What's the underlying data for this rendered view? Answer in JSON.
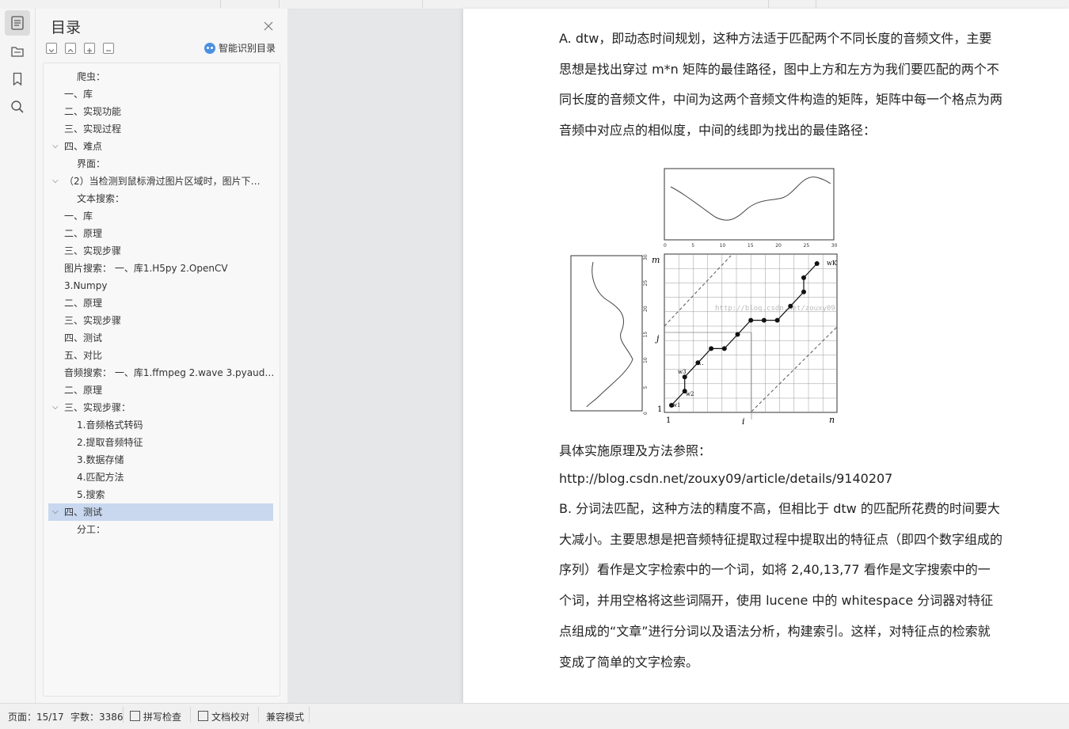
{
  "toc": {
    "title": "目录",
    "smart_label": "智能识别目录",
    "items": [
      {
        "text": "爬虫：",
        "indent": 2,
        "chevron": false,
        "selected": false
      },
      {
        "text": "一、库",
        "indent": 1,
        "chevron": false,
        "selected": false
      },
      {
        "text": "二、实现功能",
        "indent": 1,
        "chevron": false,
        "selected": false
      },
      {
        "text": "三、实现过程",
        "indent": 1,
        "chevron": false,
        "selected": false
      },
      {
        "text": "四、难点",
        "indent": 1,
        "chevron": true,
        "selected": false
      },
      {
        "text": "界面：",
        "indent": 2,
        "chevron": false,
        "selected": false
      },
      {
        "text": "（2）当检测到鼠标滑过图片区域时，图片下…",
        "indent": 1,
        "chevron": true,
        "selected": false
      },
      {
        "text": "文本搜索：",
        "indent": 2,
        "chevron": false,
        "selected": false
      },
      {
        "text": "一、库",
        "indent": 1,
        "chevron": false,
        "selected": false
      },
      {
        "text": "二、原理",
        "indent": 1,
        "chevron": false,
        "selected": false
      },
      {
        "text": "三、实现步骤",
        "indent": 1,
        "chevron": false,
        "selected": false
      },
      {
        "text": "图片搜索：  一、库1.H5py 2.OpenCV",
        "indent": 1,
        "chevron": false,
        "selected": false
      },
      {
        "text": "3.Numpy",
        "indent": 1,
        "chevron": false,
        "selected": false
      },
      {
        "text": "二、原理",
        "indent": 1,
        "chevron": false,
        "selected": false
      },
      {
        "text": "三、实现步骤",
        "indent": 1,
        "chevron": false,
        "selected": false
      },
      {
        "text": "四、测试",
        "indent": 1,
        "chevron": false,
        "selected": false
      },
      {
        "text": "五、对比",
        "indent": 1,
        "chevron": false,
        "selected": false
      },
      {
        "text": "音频搜索：  一、库1.ffmpeg 2.wave 3.pyaud…",
        "indent": 1,
        "chevron": false,
        "selected": false
      },
      {
        "text": "二、原理",
        "indent": 1,
        "chevron": false,
        "selected": false
      },
      {
        "text": "三、实现步骤：",
        "indent": 1,
        "chevron": true,
        "selected": false
      },
      {
        "text": "1.音频格式转码",
        "indent": 2,
        "chevron": false,
        "selected": false
      },
      {
        "text": "2.提取音频特征",
        "indent": 2,
        "chevron": false,
        "selected": false
      },
      {
        "text": "3.数据存储",
        "indent": 2,
        "chevron": false,
        "selected": false
      },
      {
        "text": "4.匹配方法",
        "indent": 2,
        "chevron": false,
        "selected": false
      },
      {
        "text": "5.搜索",
        "indent": 2,
        "chevron": false,
        "selected": false
      },
      {
        "text": "四、测试",
        "indent": 1,
        "chevron": true,
        "selected": true
      },
      {
        "text": "分工：",
        "indent": 2,
        "chevron": false,
        "selected": false
      }
    ]
  },
  "doc": {
    "para_a": "A.   dtw，即动态时间规划，这种方法适于匹配两个不同长度的音频文件，主要思想是找出穿过 m*n 矩阵的最佳路径，图中上方和左方为我们要匹配的两个不同长度的音频文件，中间为这两个音频文件构造的矩阵，矩阵中每一个格点为两音频中对应点的相似度，中间的线即为找出的最佳路径：",
    "ref_label": "具体实施原理及方法参照：",
    "ref_url": "http://blog.csdn.net/zouxy09/article/details/9140207",
    "para_b": "B.   分词法匹配，这种方法的精度不高，但相比于 dtw 的匹配所花费的时间要大大减小。主要思想是把音频特征提取过程中提取出的特征点（即四个数字组成的序列）看作是文字检索中的一个词，如将 2,40,13,77 看作是文字搜索中的一个词，并用空格将这些词隔开，使用 lucene 中的 whitespace 分词器对特征点组成的“文章”进行分词以及语法分析，构建索引。这样，对特征点的检索就变成了简单的文字检索。",
    "figure": {
      "top_ticks": [
        "0",
        "5",
        "10",
        "15",
        "20",
        "25",
        "30"
      ],
      "left_ticks": [
        "30",
        "25",
        "20",
        "15",
        "10",
        "5",
        "0"
      ],
      "label_m": "m",
      "label_j": "j",
      "label_i": "i",
      "label_n": "n",
      "label_1a": "1",
      "label_1b": "1",
      "label_wk": "wK",
      "label_w1": "w1",
      "label_w2": "w2",
      "label_w3": "w3",
      "label_dots": "...",
      "watermark": "http://blog.csdn.net/zouxy09"
    }
  },
  "status": {
    "page": "页面：15/17",
    "words": "字数：3386",
    "spell": "拼写检查",
    "proof": "文档校对",
    "compat": "兼容模式"
  }
}
